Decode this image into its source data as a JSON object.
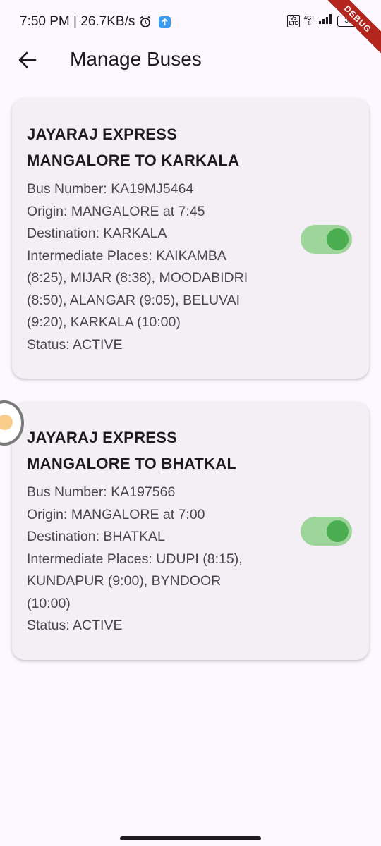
{
  "status_bar": {
    "time_speed": "7:50 PM | 26.7KB/s",
    "volte_label": "Vo LTE",
    "network_type": "4G+",
    "battery": "39",
    "debug_label": "DEBUG"
  },
  "app_bar": {
    "title": "Manage Buses",
    "back_icon": "back-arrow-icon"
  },
  "buses": [
    {
      "name": "JAYARAJ EXPRESS",
      "route": "MANGALORE TO KARKALA",
      "bus_number": "Bus Number: KA19MJ5464",
      "origin": "Origin: MANGALORE at 7:45",
      "destination": "Destination: KARKALA",
      "intermediate_lines": [
        "Intermediate Places: KAIKAMBA",
        "(8:25), MIJAR (8:38), MOODABIDRI",
        "(8:50), ALANGAR (9:05), BELUVAI",
        "(9:20), KARKALA (10:00)"
      ],
      "status": "Status: ACTIVE",
      "active": true
    },
    {
      "name": "JAYARAJ EXPRESS",
      "route": "MANGALORE TO BHATKAL",
      "bus_number": "Bus Number: KA197566",
      "origin": "Origin: MANGALORE at 7:00",
      "destination": "Destination: BHATKAL",
      "intermediate_lines": [
        "Intermediate Places: UDUPI (8:15),",
        "KUNDAPUR (9:00), BYNDOOR",
        "(10:00)"
      ],
      "status": "Status: ACTIVE",
      "active": true
    }
  ],
  "colors": {
    "background": "#fdf7ff",
    "card": "#f3eff5",
    "toggle_track": "#9ed59b",
    "toggle_thumb": "#4aae50"
  }
}
